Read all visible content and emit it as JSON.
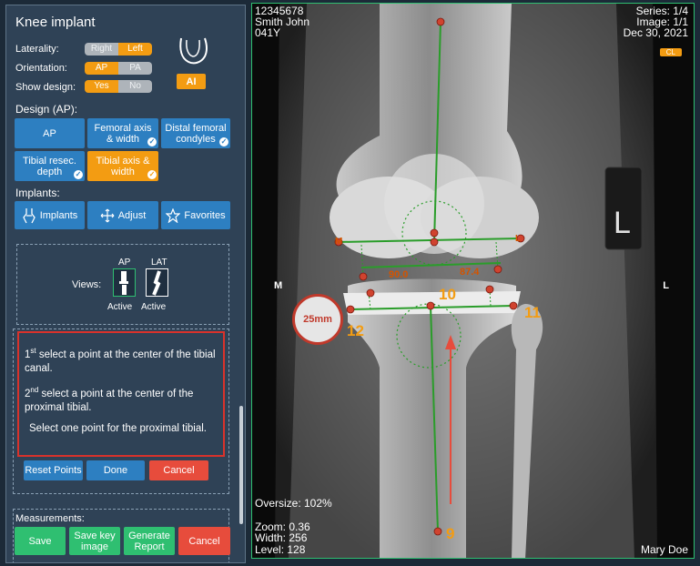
{
  "panel": {
    "title": "Knee implant",
    "laterality": {
      "label": "Laterality:",
      "opt1": "Right",
      "opt2": "Left"
    },
    "orientation": {
      "label": "Orientation:",
      "opt1": "AP",
      "opt2": "PA"
    },
    "show_design": {
      "label": "Show design:",
      "opt1": "Yes",
      "opt2": "No"
    },
    "ai_label": "AI",
    "design_heading": "Design (AP):",
    "design_buttons": [
      "AP",
      "Femoral axis & width",
      "Distal femoral condyles",
      "Tibial resec. depth",
      "Tibial axis & width"
    ],
    "implants_heading": "Implants:",
    "implant_buttons": [
      "Implants",
      "Adjust",
      "Favorites"
    ],
    "views": {
      "label": "Views:",
      "ap": "AP",
      "lat": "LAT",
      "ap_status": "Active",
      "lat_status": "Active"
    },
    "instructions": {
      "step1_ord": "1",
      "step1_sup": "st",
      "step1_text": " select a point at the center of the tibial canal.",
      "step2_ord": "2",
      "step2_sup": "nd",
      "step2_text": " select a point at the center of the proximal tibial.",
      "note": "Select one point for the proximal tibial."
    },
    "actions": {
      "reset": "Reset Points",
      "done": "Done",
      "cancel": "Cancel"
    },
    "measurements_heading": "Measurements:",
    "bottom_buttons": {
      "save": "Save",
      "save_key_image": "Save key image",
      "generate_report": "Generate Report",
      "cancel": "Cancel"
    }
  },
  "viewer": {
    "patient_id": "12345678",
    "patient_name": "Smith John",
    "patient_age": "041Y",
    "series": "Series: 1/4",
    "image": "Image: 1/1",
    "date": "Dec 30, 2021",
    "cl_badge": "CL",
    "left_marker": "M",
    "right_marker": "L",
    "oversize": "Oversize: 102%",
    "zoom": "Zoom: 0.36",
    "width": "Width: 256",
    "level": "Level: 128",
    "physician": "Mary Doe",
    "calibration": "25mm",
    "angle_left": "90.0",
    "angle_right": "87.4",
    "point_labels": [
      "9",
      "10",
      "11",
      "12"
    ],
    "condyle_left": "M",
    "condyle_right": "L",
    "film_marker": "L"
  },
  "colors": {
    "accent_orange": "#f39c12",
    "primary_blue": "#2d7fc1",
    "green": "#2fbf71",
    "red": "#e74c3c",
    "panel_bg": "#2f4256"
  }
}
